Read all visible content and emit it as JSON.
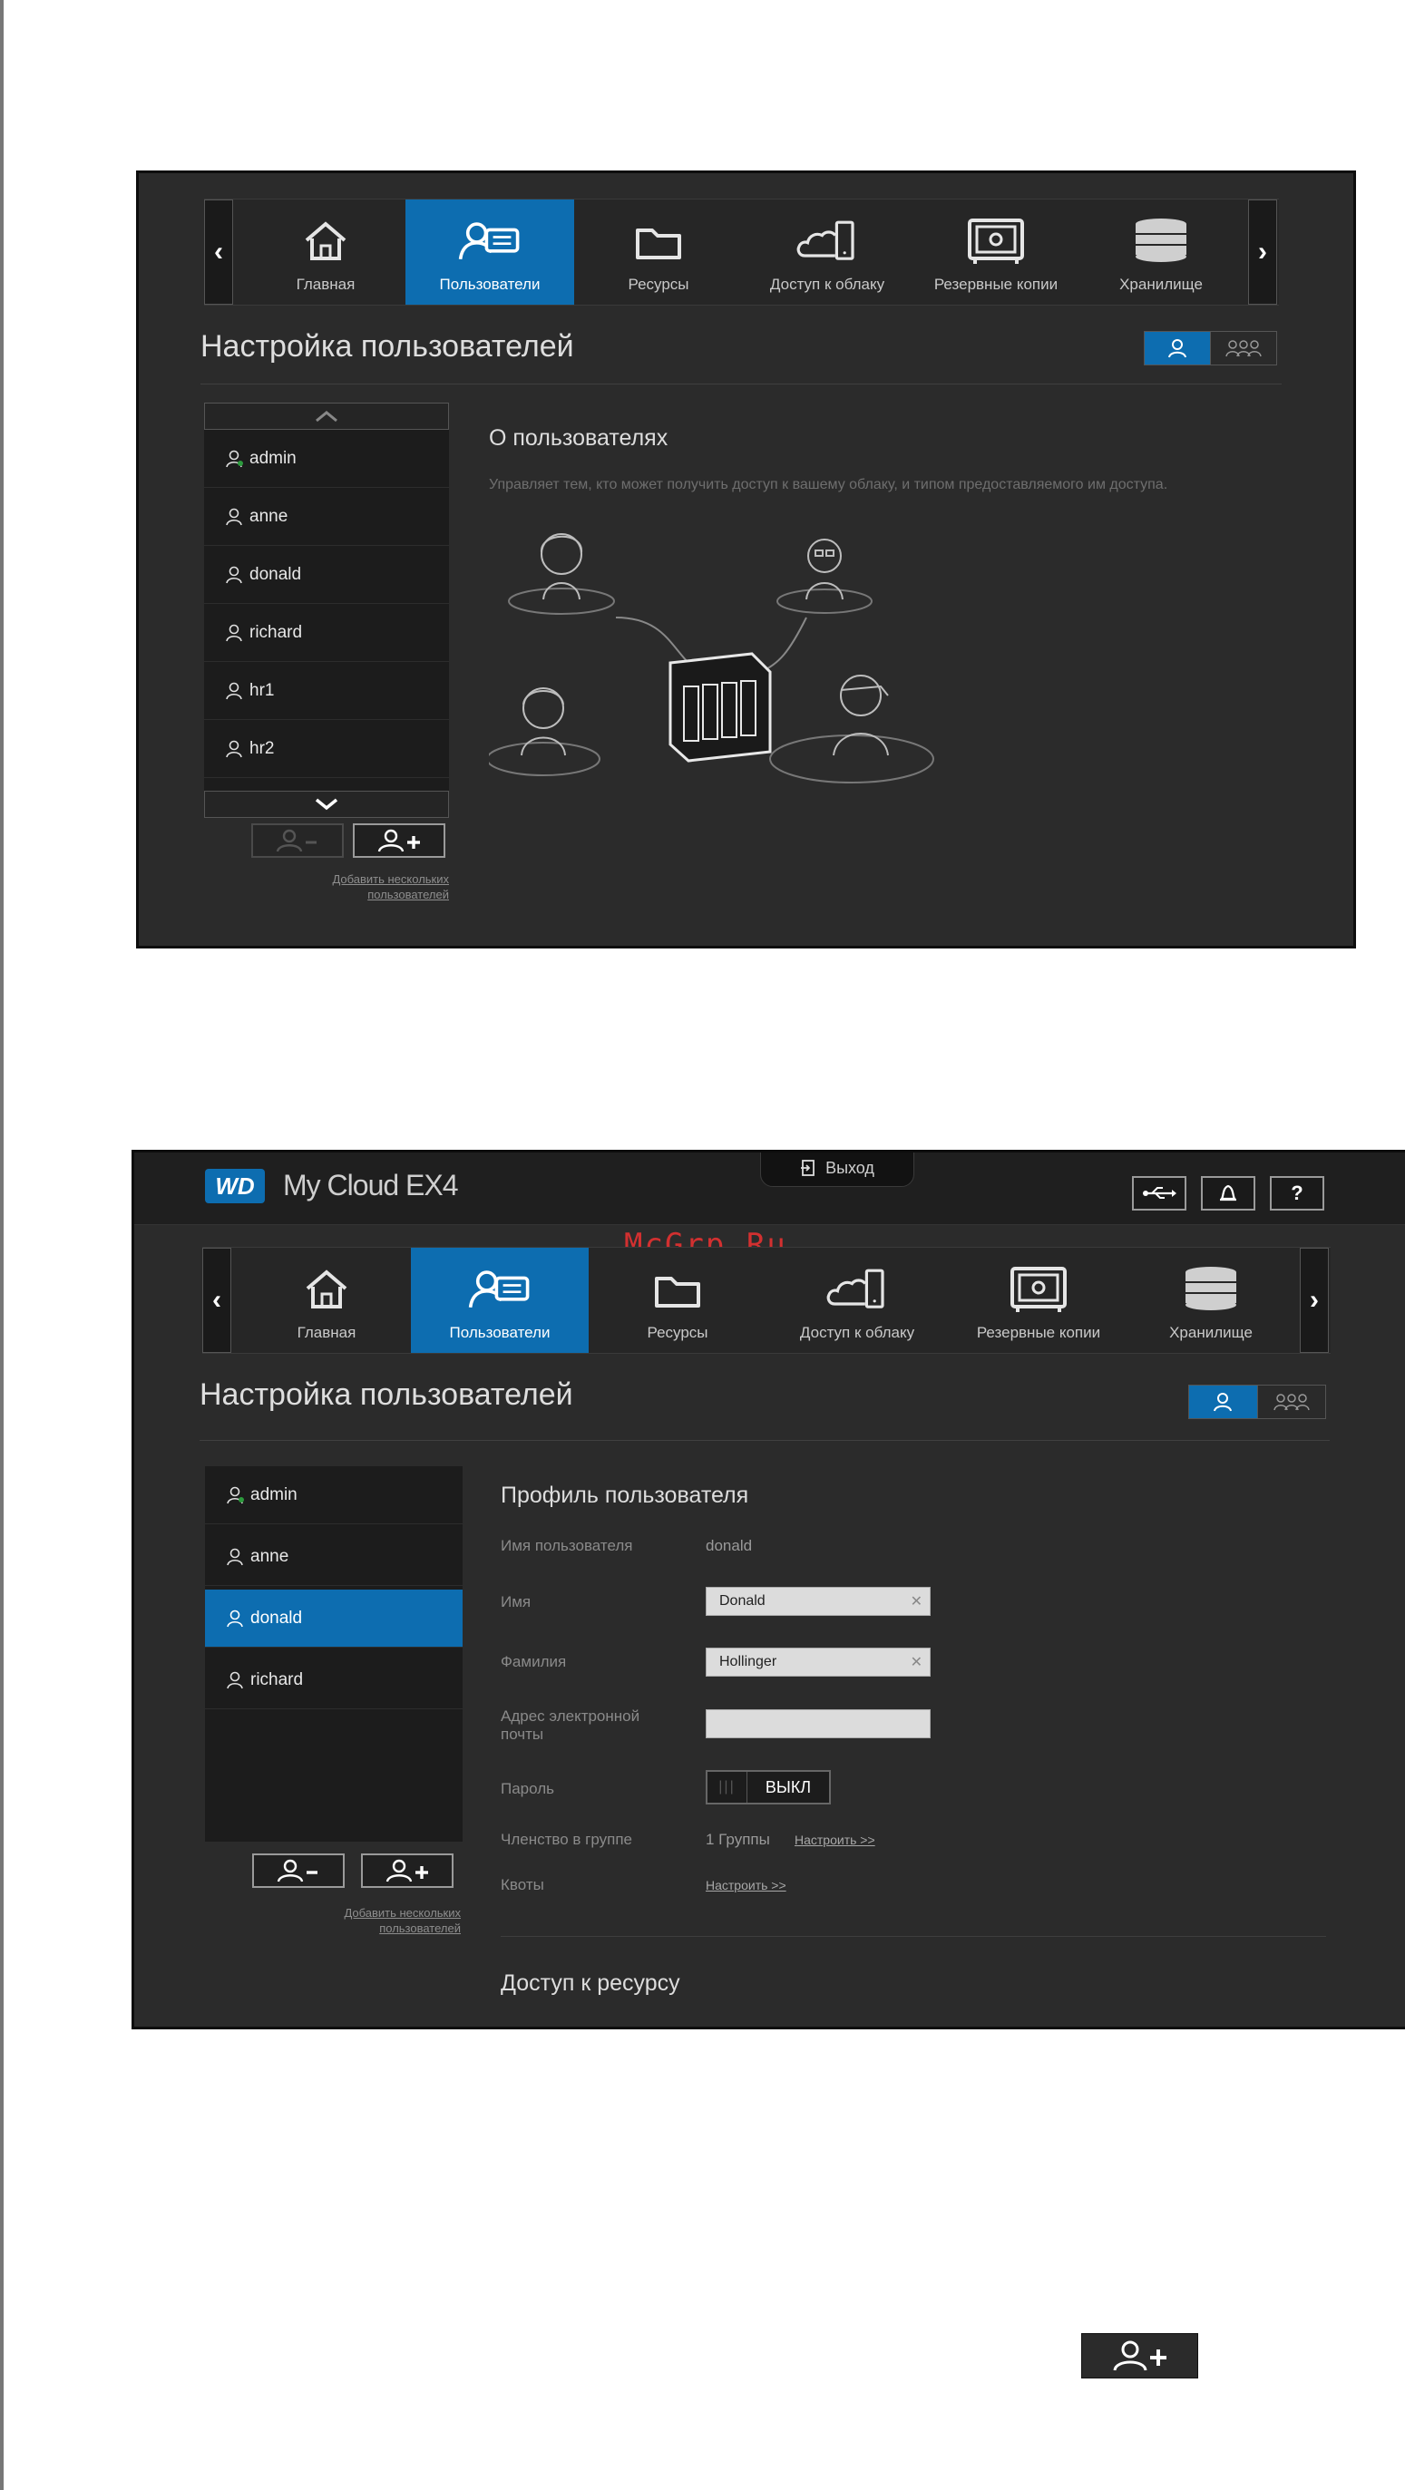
{
  "nav": {
    "items": [
      {
        "label": "Главная",
        "icon": "home-icon"
      },
      {
        "label": "Пользователи",
        "icon": "users-icon"
      },
      {
        "label": "Ресурсы",
        "icon": "folder-icon"
      },
      {
        "label": "Доступ к облаку",
        "icon": "cloud-access-icon"
      },
      {
        "label": "Резервные копии",
        "icon": "safe-icon"
      },
      {
        "label": "Хранилище",
        "icon": "storage-icon"
      }
    ],
    "active": "Пользователи"
  },
  "screen1": {
    "page_title": "Настройка пользователей",
    "users": [
      "admin",
      "anne",
      "donald",
      "richard",
      "hr1",
      "hr2"
    ],
    "add_multiple_link": "Добавить нескольких пользователей",
    "about": {
      "title": "О пользователях",
      "description": "Управляет тем, кто может получить доступ к вашему облаку, и типом предоставляемого им доступа."
    }
  },
  "screen2": {
    "header": {
      "brand": "WD",
      "product": "My Cloud EX4",
      "logout": "Выход",
      "help_label": "?"
    },
    "watermark": "McGrp.Ru",
    "page_title": "Настройка пользователей",
    "users": [
      "admin",
      "anne",
      "donald",
      "richard"
    ],
    "selected_user": "donald",
    "add_multiple_link": "Добавить нескольких пользователей",
    "profile": {
      "title": "Профиль пользователя",
      "username_label": "Имя пользователя",
      "username_value": "donald",
      "first_name_label": "Имя",
      "first_name_value": "Donald",
      "last_name_label": "Фамилия",
      "last_name_value": "Hollinger",
      "email_label": "Адрес электронной почты",
      "email_value": "",
      "password_label": "Пароль",
      "password_state": "ВЫКЛ",
      "group_label": "Членство в группе",
      "group_value": "1 Группы",
      "group_link": "Настроить >>",
      "quota_label": "Квоты",
      "quota_link": "Настроить >>"
    },
    "share_access_title": "Доступ к ресурсу"
  },
  "colors": {
    "accent": "#0d6db0",
    "panel": "#2b2b2b",
    "watermark": "#d23030"
  }
}
